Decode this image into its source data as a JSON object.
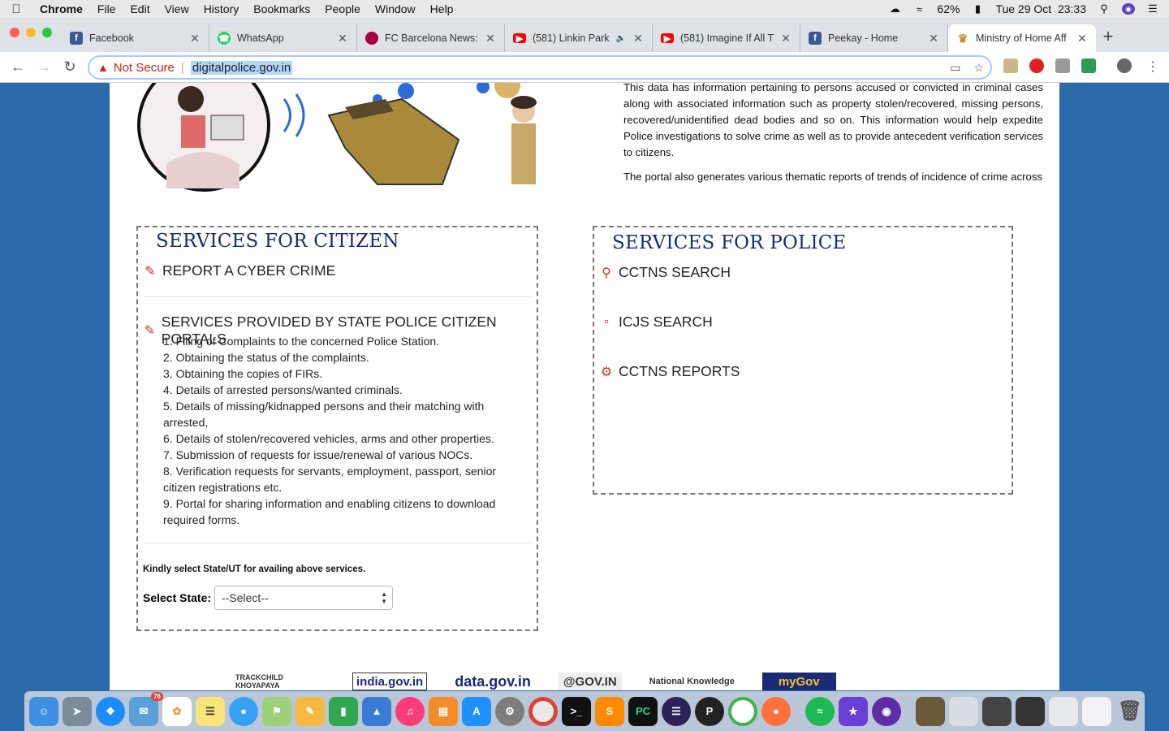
{
  "menubar": {
    "app_name": "Chrome",
    "menus": [
      "File",
      "Edit",
      "View",
      "History",
      "Bookmarks",
      "People",
      "Window",
      "Help"
    ],
    "battery": "62%",
    "datetime": "Tue 29 Oct  23:33"
  },
  "tabs": [
    {
      "title": "Facebook",
      "favicon": "facebook-icon",
      "color": "#3b5998"
    },
    {
      "title": "WhatsApp",
      "favicon": "whatsapp-icon",
      "color": "#25d366"
    },
    {
      "title": "FC Barcelona News:",
      "favicon": "fcb-icon",
      "color": "#a50044"
    },
    {
      "title": "(581) Linkin Park",
      "favicon": "youtube-icon",
      "color": "#ff0000"
    },
    {
      "title": "(581) Imagine If All T",
      "favicon": "youtube-icon",
      "color": "#ff0000"
    },
    {
      "title": "Peekay - Home",
      "favicon": "facebook-icon",
      "color": "#3b5998"
    },
    {
      "title": "Ministry of Home Aff",
      "favicon": "emblem-icon",
      "color": "#c8922a"
    }
  ],
  "omnibox": {
    "security_label": "Not Secure",
    "url": "digitalpolice.gov.in"
  },
  "intro": {
    "para1": "This data has information pertaining to persons accused or convicted in criminal cases along with associated information such as property stolen/recovered, missing persons, recovered/unidentified dead bodies and so on. This information would help expedite Police investigations to solve crime as well as to provide antecedent verification services to citizens.",
    "para2": "The portal also generates various thematic reports of trends of incidence of crime across"
  },
  "citizen": {
    "heading": "SERVICES FOR CITIZEN",
    "report_cyber_crime": "REPORT A CYBER CRIME",
    "state_portals": "SERVICES PROVIDED BY STATE POLICE CITIZEN PORTALS",
    "items": [
      "1. Filing of Complaints to the concerned Police Station.",
      "2. Obtaining the status of the complaints.",
      "3. Obtaining the copies of FIRs.",
      "4. Details of arrested persons/wanted criminals.",
      "5. Details of missing/kidnapped persons and their matching with arrested,",
      "6. Details of stolen/recovered vehicles, arms and other properties.",
      "7. Submission of requests for issue/renewal of various NOCs.",
      "8. Verification requests for servants, employment, passport, senior citizen registrations etc.",
      "9. Portal for sharing information and enabling citizens to download required forms."
    ],
    "state_note": "Kindly select State/UT for availing above services.",
    "select_label": "Select State:",
    "select_value": "--Select--"
  },
  "police": {
    "heading": "SERVICES FOR POLICE",
    "cctns_search": "CCTNS SEARCH",
    "icjs_search": "ICJS SEARCH",
    "cctns_reports": "CCTNS REPORTS"
  },
  "footer_logos": [
    "TRACKCHILD KHOYAPAYA",
    "india.gov.in",
    "data.gov.in",
    "@GOV.IN",
    "National Knowledge",
    "myGov"
  ],
  "dock": {
    "app_store_badge": "76"
  }
}
